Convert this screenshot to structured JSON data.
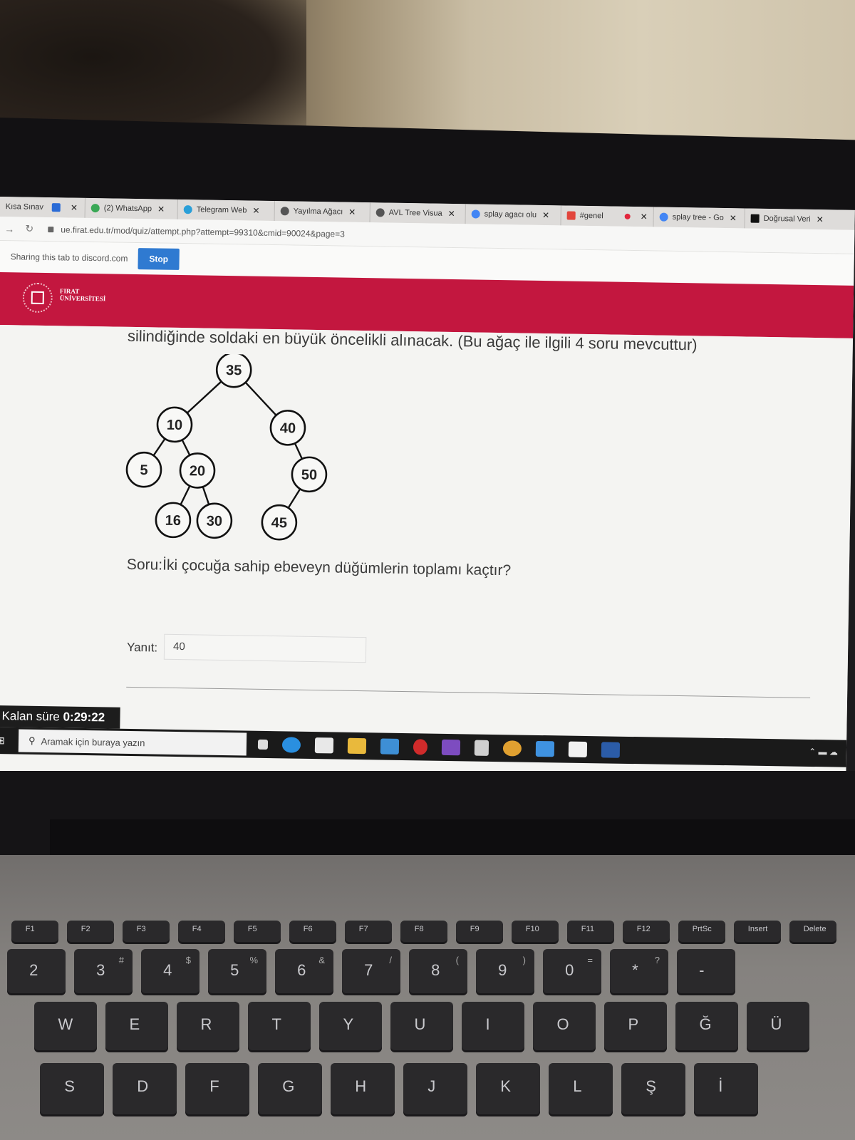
{
  "browser": {
    "tabs": [
      {
        "label": "Kısa Sınav",
        "icon": "moodle-icon",
        "color": "#2a6bd6"
      },
      {
        "label": "(2) WhatsApp",
        "icon": "whatsapp-icon",
        "color": "#3aa856"
      },
      {
        "label": "Telegram Web",
        "icon": "telegram-icon",
        "color": "#2a9fd8"
      },
      {
        "label": "Yayılma Ağacı",
        "icon": "globe-icon",
        "color": "#444444"
      },
      {
        "label": "AVL Tree Visua",
        "icon": "globe-icon",
        "color": "#444444"
      },
      {
        "label": "splay agacı olu",
        "icon": "google-icon",
        "color": "#4285f4"
      },
      {
        "label": "#genel",
        "icon": "discord-icon",
        "color": "#e2453c"
      },
      {
        "label": "splay tree - Go",
        "icon": "google-icon",
        "color": "#4285f4"
      },
      {
        "label": "Doğrusal Veri",
        "icon": "medium-icon",
        "color": "#111111"
      }
    ],
    "url": "ue.firat.edu.tr/mod/quiz/attempt.php?attempt=99310&cmid=90024&page=3"
  },
  "share_bar": {
    "message": "Sharing this tab to discord.com",
    "stop_label": "Stop"
  },
  "university": {
    "name_line1": "FIRAT",
    "name_line2": "ÜNİVERSİTESİ",
    "banner_color": "#c3173f"
  },
  "question": {
    "intro_text": "silindiğinde soldaki en büyük öncelikli alınacak. (Bu ağaç ile ilgili 4 soru mevcuttur)",
    "prompt": "Soru:İki çocuğa sahip ebeveyn düğümlerin toplamı kaçtır?",
    "answer_label": "Yanıt:",
    "answer_value": "40"
  },
  "tree": {
    "nodes": [
      {
        "id": "n35",
        "value": "35"
      },
      {
        "id": "n10",
        "value": "10"
      },
      {
        "id": "n40",
        "value": "40"
      },
      {
        "id": "n5",
        "value": "5"
      },
      {
        "id": "n20",
        "value": "20"
      },
      {
        "id": "n50",
        "value": "50"
      },
      {
        "id": "n16",
        "value": "16"
      },
      {
        "id": "n30",
        "value": "30"
      },
      {
        "id": "n45",
        "value": "45"
      }
    ],
    "edges": [
      [
        "n35",
        "n10"
      ],
      [
        "n35",
        "n40"
      ],
      [
        "n10",
        "n5"
      ],
      [
        "n10",
        "n20"
      ],
      [
        "n40",
        "n50"
      ],
      [
        "n20",
        "n16"
      ],
      [
        "n20",
        "n30"
      ],
      [
        "n50",
        "n45"
      ]
    ]
  },
  "timer": {
    "label": "Kalan süre",
    "value": "0:29:22"
  },
  "taskbar": {
    "search_placeholder": "Aramak için buraya yazın"
  },
  "keyboard": {
    "function_row": [
      "F1",
      "F2",
      "F3",
      "F4",
      "F5",
      "F6",
      "F7",
      "F8",
      "F9",
      "F10",
      "F11",
      "F12",
      "PrtSc",
      "Insert",
      "Delete"
    ],
    "number_row": [
      {
        "main": "2",
        "shift": ""
      },
      {
        "main": "3",
        "shift": "#"
      },
      {
        "main": "4",
        "shift": "$"
      },
      {
        "main": "5",
        "shift": "%"
      },
      {
        "main": "6",
        "shift": "&"
      },
      {
        "main": "7",
        "shift": "/"
      },
      {
        "main": "8",
        "shift": "("
      },
      {
        "main": "9",
        "shift": ")"
      },
      {
        "main": "0",
        "shift": "="
      },
      {
        "main": "*",
        "shift": "?"
      },
      {
        "main": "-",
        "shift": ""
      }
    ],
    "top_row": [
      "W",
      "E",
      "R",
      "T",
      "Y",
      "U",
      "I",
      "O",
      "P",
      "Ğ",
      "Ü"
    ],
    "home_row": [
      "S",
      "D",
      "F",
      "G",
      "H",
      "J",
      "K",
      "L",
      "Ş",
      "İ"
    ]
  }
}
